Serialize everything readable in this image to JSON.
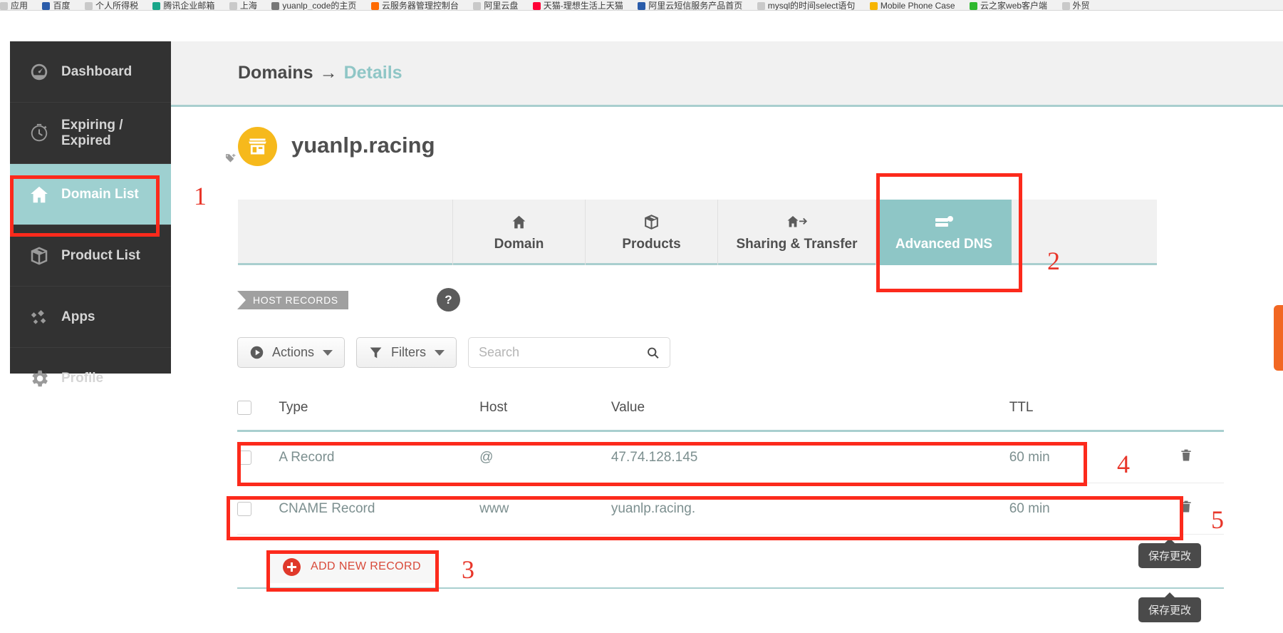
{
  "browser": {
    "bookmarks": [
      {
        "label": "应用",
        "favicon": "#c9c9c9"
      },
      {
        "label": "百度",
        "favicon": "#2a5caa"
      },
      {
        "label": "个人所得税",
        "favicon": "#c9c9c9"
      },
      {
        "label": "腾讯企业邮箱",
        "favicon": "#18a689"
      },
      {
        "label": "上海",
        "favicon": "#c9c9c9"
      },
      {
        "label": "yuanlp_code的主页",
        "favicon": "#777777"
      },
      {
        "label": "云服务器管理控制台",
        "favicon": "#ff6a00"
      },
      {
        "label": "阿里云盘",
        "favicon": "#c9c9c9"
      },
      {
        "label": "天猫-理想生活上天猫",
        "favicon": "#ff0036"
      },
      {
        "label": "阿里云短信服务产品首页",
        "favicon": "#2a5caa"
      },
      {
        "label": "mysql的时间select语句",
        "favicon": "#c9c9c9"
      },
      {
        "label": "Mobile Phone Case",
        "favicon": "#f7b500"
      },
      {
        "label": "云之家web客户端",
        "favicon": "#2eb82e"
      },
      {
        "label": "外贸",
        "favicon": "#c9c9c9"
      }
    ]
  },
  "sidebar": {
    "items": [
      {
        "label": "Dashboard",
        "icon": "gauge-icon",
        "active": false
      },
      {
        "label": "Expiring / Expired",
        "icon": "stopwatch-icon",
        "active": false
      },
      {
        "label": "Domain List",
        "icon": "home-icon",
        "active": true
      },
      {
        "label": "Product List",
        "icon": "box-icon",
        "active": false
      },
      {
        "label": "Apps",
        "icon": "diamonds-icon",
        "active": false
      },
      {
        "label": "Profile",
        "icon": "gear-icon",
        "active": false
      }
    ]
  },
  "breadcrumb": {
    "root": "Domains",
    "separator": "→",
    "current": "Details"
  },
  "domain": {
    "name": "yuanlp.racing",
    "avatar_icon": "store-icon",
    "tag_icon": "add-tag-icon"
  },
  "tabs": [
    {
      "label": "Domain",
      "icon": "house-icon",
      "active": false
    },
    {
      "label": "Products",
      "icon": "package-icon",
      "active": false
    },
    {
      "label": "Sharing & Transfer",
      "icon": "house-transfer-icon",
      "active": false
    },
    {
      "label": "Advanced DNS",
      "icon": "dns-server-icon",
      "active": true
    }
  ],
  "section": {
    "ribbon_label": "HOST RECORDS",
    "help_label": "?"
  },
  "toolbar": {
    "actions_label": "Actions",
    "actions_icon": "play-circle-icon",
    "filters_label": "Filters",
    "filters_icon": "funnel-icon",
    "search_value": "",
    "search_placeholder": "Search",
    "search_icon": "search-icon"
  },
  "table": {
    "columns": [
      "Type",
      "Host",
      "Value",
      "TTL"
    ],
    "rows": [
      {
        "type": "A Record",
        "host": "@",
        "value": "47.74.128.145",
        "ttl": "60 min",
        "delete_icon": "trash-icon"
      },
      {
        "type": "CNAME Record",
        "host": "www",
        "value": "yuanlp.racing.",
        "ttl": "60 min",
        "delete_icon": "trash-icon"
      }
    ]
  },
  "add_record": {
    "label": "ADD NEW RECORD",
    "icon": "plus-circle-icon"
  },
  "tooltips": [
    {
      "text": "保存更改"
    },
    {
      "text": "保存更改"
    }
  ],
  "annotations": [
    {
      "number": "1"
    },
    {
      "number": "2"
    },
    {
      "number": "3"
    },
    {
      "number": "4"
    },
    {
      "number": "5"
    }
  ],
  "colors": {
    "accent_teal": "#8ec6c6",
    "sidebar_dark": "#323232",
    "annotation_red": "#fc2a1c",
    "avatar_yellow": "#f6b91c",
    "add_record_red": "#e0392b",
    "feedback_orange": "#f26722"
  }
}
